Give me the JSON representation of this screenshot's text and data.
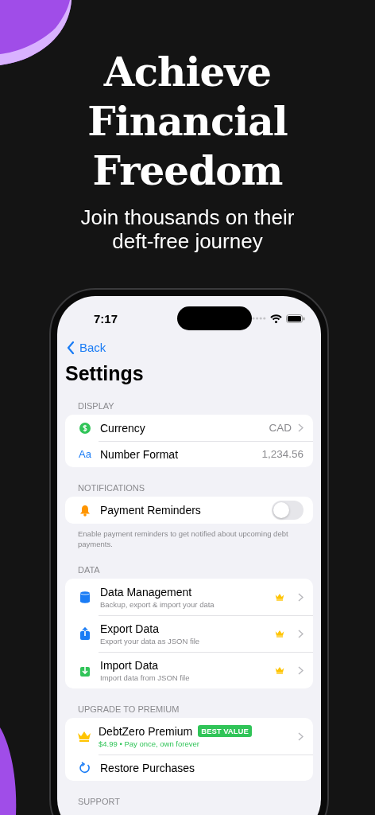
{
  "headline": [
    "Achieve",
    "Financial",
    "Freedom"
  ],
  "subtitle": "Join thousands on their deft-free journey",
  "status_bar": {
    "time": "7:17"
  },
  "nav": {
    "back": "Back",
    "title": "Settings"
  },
  "sections": [
    {
      "header": "DISPLAY",
      "rows": [
        {
          "kind": "value",
          "label": "Currency",
          "value": "CAD",
          "chevron": true
        },
        {
          "kind": "value",
          "icon_text": "Aa",
          "label": "Number Format",
          "value": "1,234.56",
          "chevron": false
        }
      ]
    },
    {
      "header": "NOTIFICATIONS",
      "rows": [
        {
          "kind": "toggle",
          "label": "Payment Reminders",
          "on": false
        }
      ],
      "footer": "Enable payment reminders to get notified about upcoming debt payments."
    },
    {
      "header": "DATA",
      "rows": [
        {
          "kind": "link",
          "label": "Data Management",
          "subtitle": "Backup, export & import your data",
          "premium": true,
          "chevron": true
        },
        {
          "kind": "link",
          "label": "Export Data",
          "subtitle": "Export your data as JSON file",
          "premium": true,
          "chevron": true
        },
        {
          "kind": "link",
          "label": "Import Data",
          "subtitle": "Import data from JSON file",
          "premium": true,
          "chevron": true
        }
      ]
    },
    {
      "header": "UPGRADE TO PREMIUM",
      "rows": [
        {
          "kind": "offer",
          "label": "DebtZero Premium",
          "badge": "BEST VALUE",
          "subtitle": "$4.99 • Pay once, own forever",
          "chevron": true
        },
        {
          "kind": "action",
          "label": "Restore Purchases"
        }
      ]
    },
    {
      "header": "SUPPORT"
    }
  ]
}
